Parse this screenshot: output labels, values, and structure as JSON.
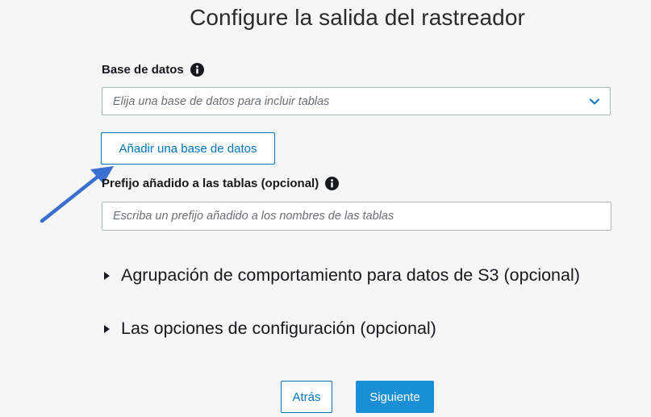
{
  "page": {
    "title": "Configure la salida del rastreador"
  },
  "database": {
    "label": "Base de datos",
    "placeholder": "Elija una base de datos para incluir tablas",
    "add_button": "Añadir una base de datos"
  },
  "prefix": {
    "label": "Prefijo añadido a las tablas (opcional)",
    "placeholder": "Escriba un prefijo añadido a los nombres de las tablas"
  },
  "expanders": [
    {
      "label": "Agrupación de comportamiento para datos de S3 (opcional)"
    },
    {
      "label": "Las opciones de configuración (opcional)"
    }
  ],
  "footer": {
    "back_label": "Atrás",
    "next_label": "Siguiente"
  },
  "icons": {
    "info": "info-icon",
    "dropdown": "chevron-down-icon",
    "expander": "caret-right-icon",
    "annotation": "arrow-icon"
  },
  "colors": {
    "accent": "#0073bb",
    "primary_button": "#1a8fd6",
    "annotation_arrow": "#3a6fd0"
  }
}
